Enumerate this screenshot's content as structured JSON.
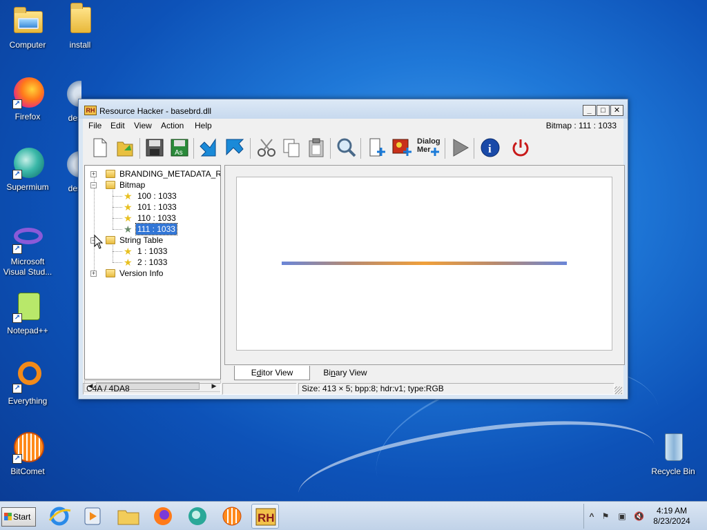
{
  "desktop": {
    "icons": [
      {
        "label": "Computer"
      },
      {
        "label": "install"
      },
      {
        "label": "Firefox"
      },
      {
        "label": "des"
      },
      {
        "label": "Supermium"
      },
      {
        "label": "des"
      },
      {
        "label": "Microsoft Visual Stud..."
      },
      {
        "label": "Notepad++"
      },
      {
        "label": "Everything"
      },
      {
        "label": "BitComet"
      },
      {
        "label": "Recycle Bin"
      }
    ]
  },
  "window": {
    "title": "Resource Hacker - basebrd.dll",
    "logo_text": "RH",
    "controls": {
      "minimize": "_",
      "maximize": "□",
      "close": "✕"
    },
    "menu": [
      "File",
      "Edit",
      "View",
      "Action",
      "Help"
    ],
    "menu_status": "Bitmap : 111 : 1033",
    "toolbar_dialog_label_1": "Dialog",
    "toolbar_dialog_label_2": "Mer",
    "tree": {
      "items": [
        {
          "label": "BRANDING_METADATA_RE"
        },
        {
          "label": "Bitmap"
        },
        {
          "label": "100 : 1033"
        },
        {
          "label": "101 : 1033"
        },
        {
          "label": "110 : 1033"
        },
        {
          "label": "111 : 1033"
        },
        {
          "label": "String Table"
        },
        {
          "label": "1 : 1033"
        },
        {
          "label": "2 : 1033"
        },
        {
          "label": "Version Info"
        }
      ]
    },
    "tabs": {
      "editor_first": "E",
      "editor_underlined": "d",
      "editor_rest": "itor View",
      "binary_first": "Bi",
      "binary_underlined": "n",
      "binary_rest": "ary View"
    },
    "status": {
      "offset": "C4A / 4DA8",
      "middle": "",
      "info": "Size: 413 × 5;  bpp:8;  hdr:v1;  type:RGB"
    }
  },
  "taskbar": {
    "start_label": "Start",
    "clock_time": "4:19 AM",
    "clock_date": "8/23/2024",
    "tray_chevron": "^"
  },
  "colors": {
    "selection": "#3276d6",
    "bitmap_left": "#6a86d8",
    "bitmap_center": "#f0a03a"
  }
}
